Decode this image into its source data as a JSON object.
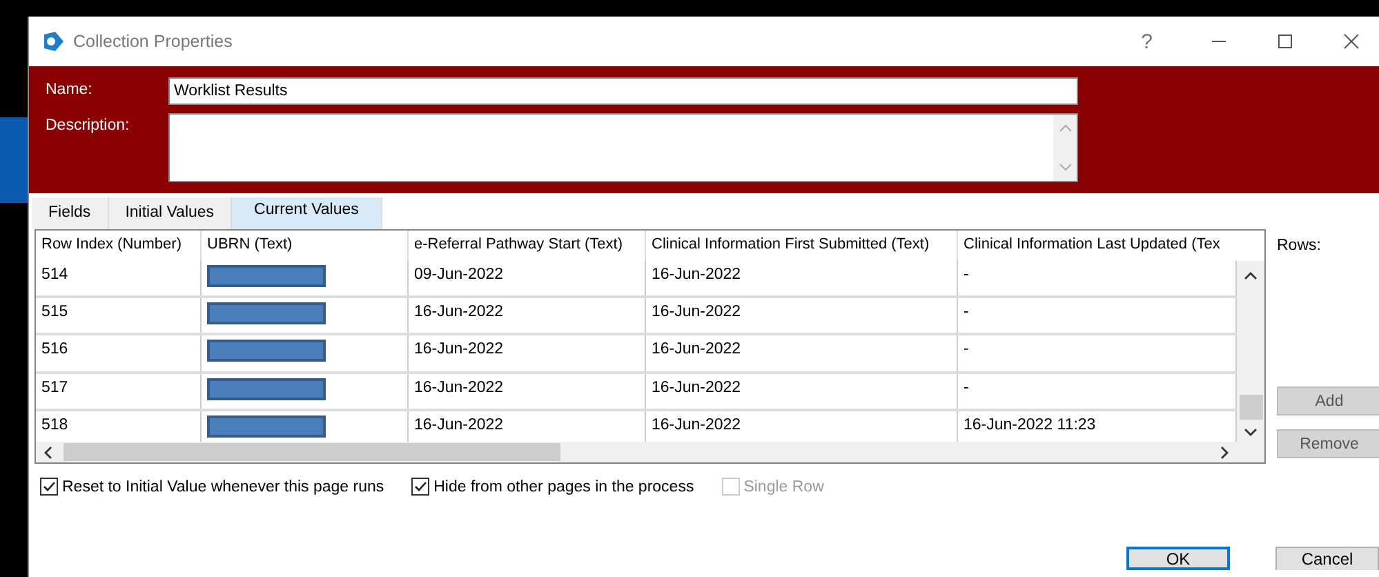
{
  "window": {
    "title": "Collection Properties",
    "help": "?"
  },
  "form": {
    "name_label": "Name:",
    "name_value": "Worklist Results",
    "description_label": "Description:"
  },
  "tabs": [
    {
      "label": "Fields",
      "selected": false
    },
    {
      "label": "Initial Values",
      "selected": false
    },
    {
      "label": "Current Values",
      "selected": true
    }
  ],
  "table": {
    "columns": [
      "Row Index  (Number)",
      "UBRN  (Text)",
      "e-Referral Pathway Start  (Text)",
      "Clinical Information First Submitted  (Text)",
      "Clinical Information Last Updated  (Tex"
    ],
    "rows": [
      {
        "row_index": "514",
        "ubrn_redacted": true,
        "pathway_start": "09-Jun-2022",
        "first_submitted": "16-Jun-2022",
        "last_updated": "-"
      },
      {
        "row_index": "515",
        "ubrn_redacted": true,
        "pathway_start": "16-Jun-2022",
        "first_submitted": "16-Jun-2022",
        "last_updated": "-"
      },
      {
        "row_index": "516",
        "ubrn_redacted": true,
        "pathway_start": "16-Jun-2022",
        "first_submitted": "16-Jun-2022",
        "last_updated": "-"
      },
      {
        "row_index": "517",
        "ubrn_redacted": true,
        "pathway_start": "16-Jun-2022",
        "first_submitted": "16-Jun-2022",
        "last_updated": "-"
      },
      {
        "row_index": "518",
        "ubrn_redacted": true,
        "pathway_start": "16-Jun-2022",
        "first_submitted": "16-Jun-2022",
        "last_updated": "16-Jun-2022 11:23"
      }
    ]
  },
  "rows_panel": {
    "label": "Rows:",
    "buttons": [
      {
        "label": "Add",
        "disabled": true
      },
      {
        "label": "Remove",
        "disabled": true
      }
    ]
  },
  "options": [
    {
      "label": "Reset to Initial Value whenever this page runs",
      "checked": true,
      "disabled": false
    },
    {
      "label": "Hide from other pages in the process",
      "checked": true,
      "disabled": false
    },
    {
      "label": "Single Row",
      "checked": false,
      "disabled": true
    }
  ],
  "buttons": [
    {
      "label": "OK",
      "kind": "default"
    },
    {
      "label": "Cancel",
      "kind": "normal"
    }
  ]
}
